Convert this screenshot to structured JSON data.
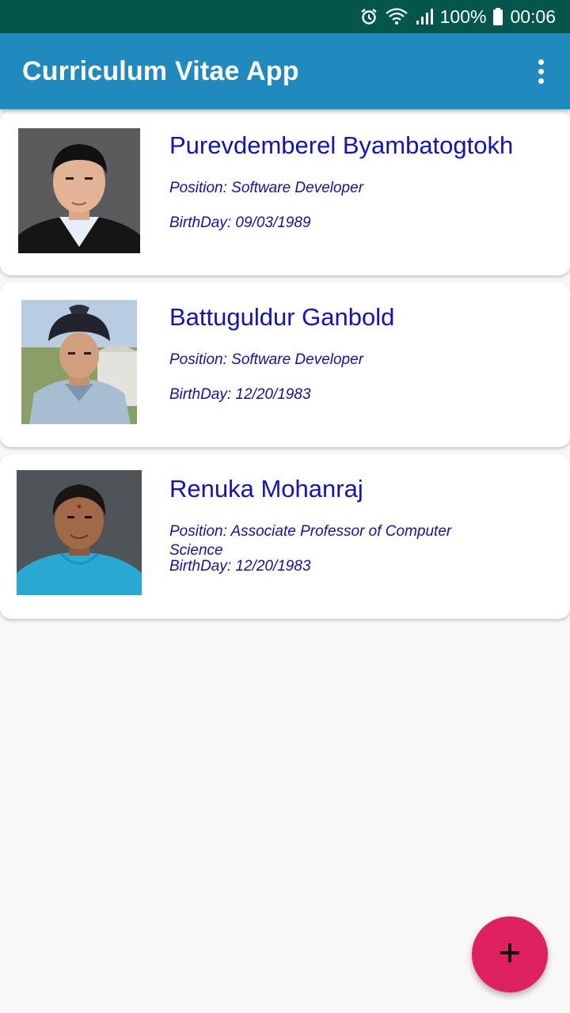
{
  "status_bar": {
    "battery": "100%",
    "time": "00:06",
    "icons": [
      "alarm-icon",
      "wifi-icon",
      "signal-icon",
      "battery-icon"
    ]
  },
  "app_bar": {
    "title": "Curriculum Vitae App",
    "menu_icon": "more-vert-icon"
  },
  "profiles": [
    {
      "name": "Purevdemberel Byambatogtokh",
      "position": "Position: Software Developer",
      "birthday": "BirthDay: 09/03/1989"
    },
    {
      "name": "Battuguldur Ganbold",
      "position": "Position: Software Developer",
      "birthday": "BirthDay: 12/20/1983"
    },
    {
      "name": "Renuka Mohanraj",
      "position": "Position: Associate Professor of Computer Science",
      "birthday": "BirthDay: 12/20/1983"
    }
  ],
  "fab": {
    "icon": "add-icon"
  },
  "colors": {
    "status_bar": "#02574a",
    "app_bar": "#2089bd",
    "name_text": "#1212c4",
    "detail_text": "#1212a8",
    "fab": "#e0215f"
  }
}
